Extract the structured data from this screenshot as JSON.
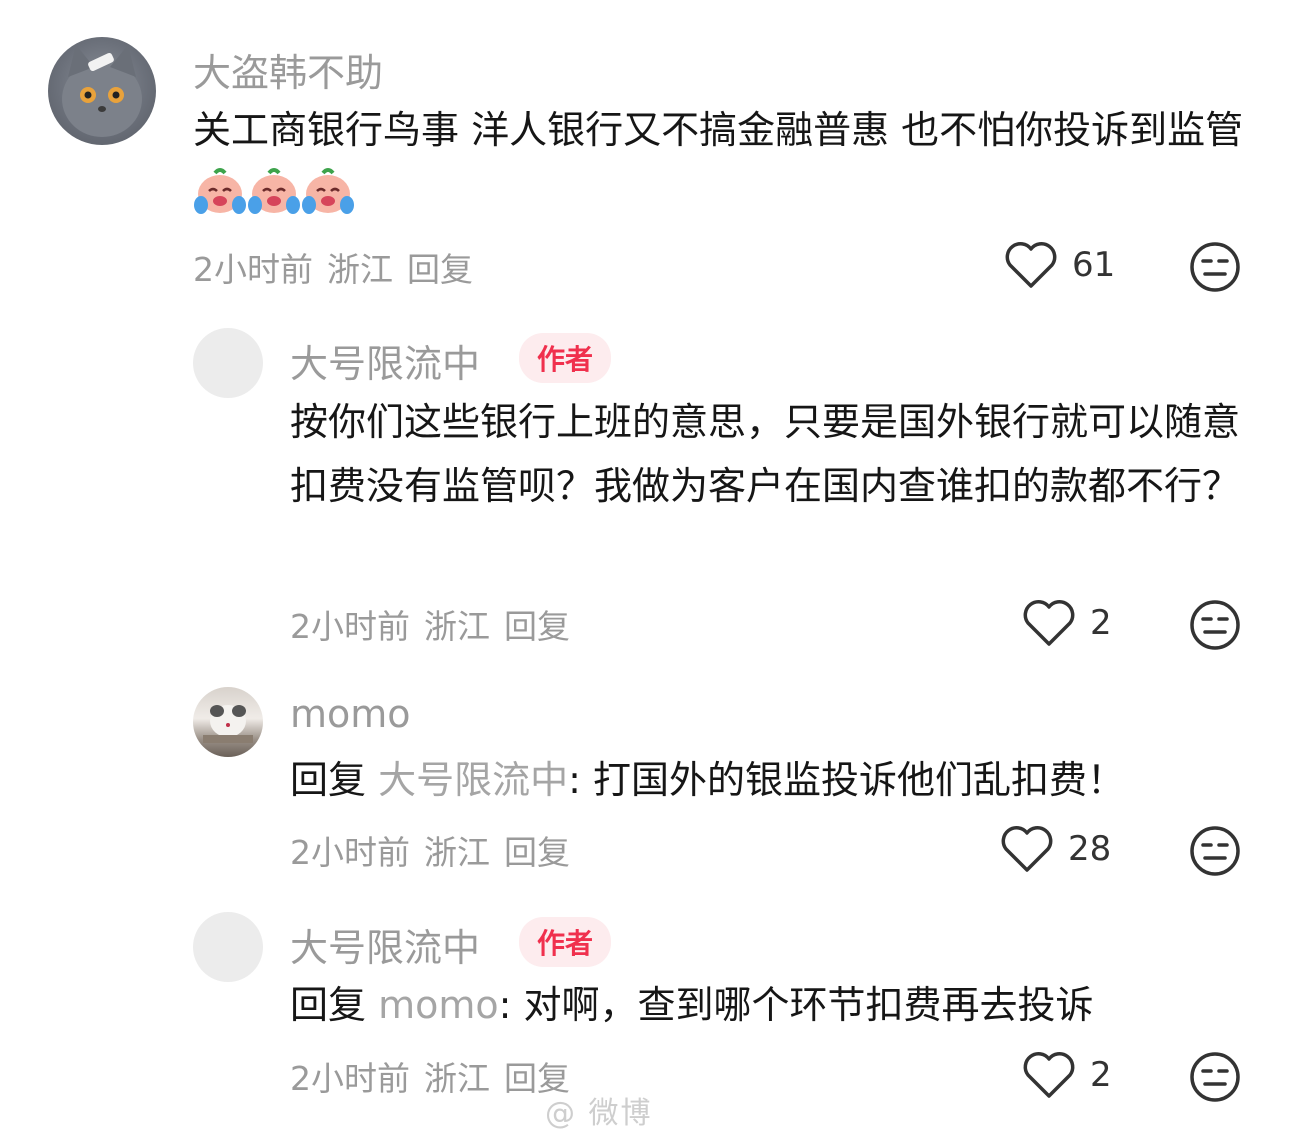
{
  "comments": [
    {
      "name": "大盗韩不助",
      "text": "关工商银行鸟事 洋人银行又不搞金融普惠 也不怕你投诉到监管",
      "emoji": [
        "crying-face-emoji",
        "crying-face-emoji",
        "crying-face-emoji"
      ],
      "meta": {
        "time": "2小时前",
        "location": "浙江",
        "reply": "回复"
      },
      "likes": "61"
    },
    {
      "name": "大号限流中",
      "badge": "作者",
      "text": "按你们这些银行上班的意思，只要是国外银行就可以随意扣费没有监管呗？我做为客户在国内查谁扣的款都不行？",
      "meta": {
        "time": "2小时前",
        "location": "浙江",
        "reply": "回复"
      },
      "likes": "2"
    },
    {
      "name": "momo",
      "reply_prefix": "回复",
      "reply_to": "大号限流中",
      "text": ": 打国外的银监投诉他们乱扣费！",
      "meta": {
        "time": "2小时前",
        "location": "浙江",
        "reply": "回复"
      },
      "likes": "28"
    },
    {
      "name": "大号限流中",
      "badge": "作者",
      "reply_prefix": "回复",
      "reply_to": "momo",
      "text": ": 对啊，查到哪个环节扣费再去投诉",
      "meta": {
        "time": "2小时前",
        "location": "浙江",
        "reply": "回复"
      },
      "likes": "2"
    }
  ],
  "icons": {
    "like": "heart-outline-icon",
    "dislike": "neutral-face-icon"
  },
  "colors": {
    "badge_bg": "#fdecee",
    "badge_text": "#f0304d",
    "secondary_text": "#9a9a9a"
  },
  "watermark": "@ 微博"
}
